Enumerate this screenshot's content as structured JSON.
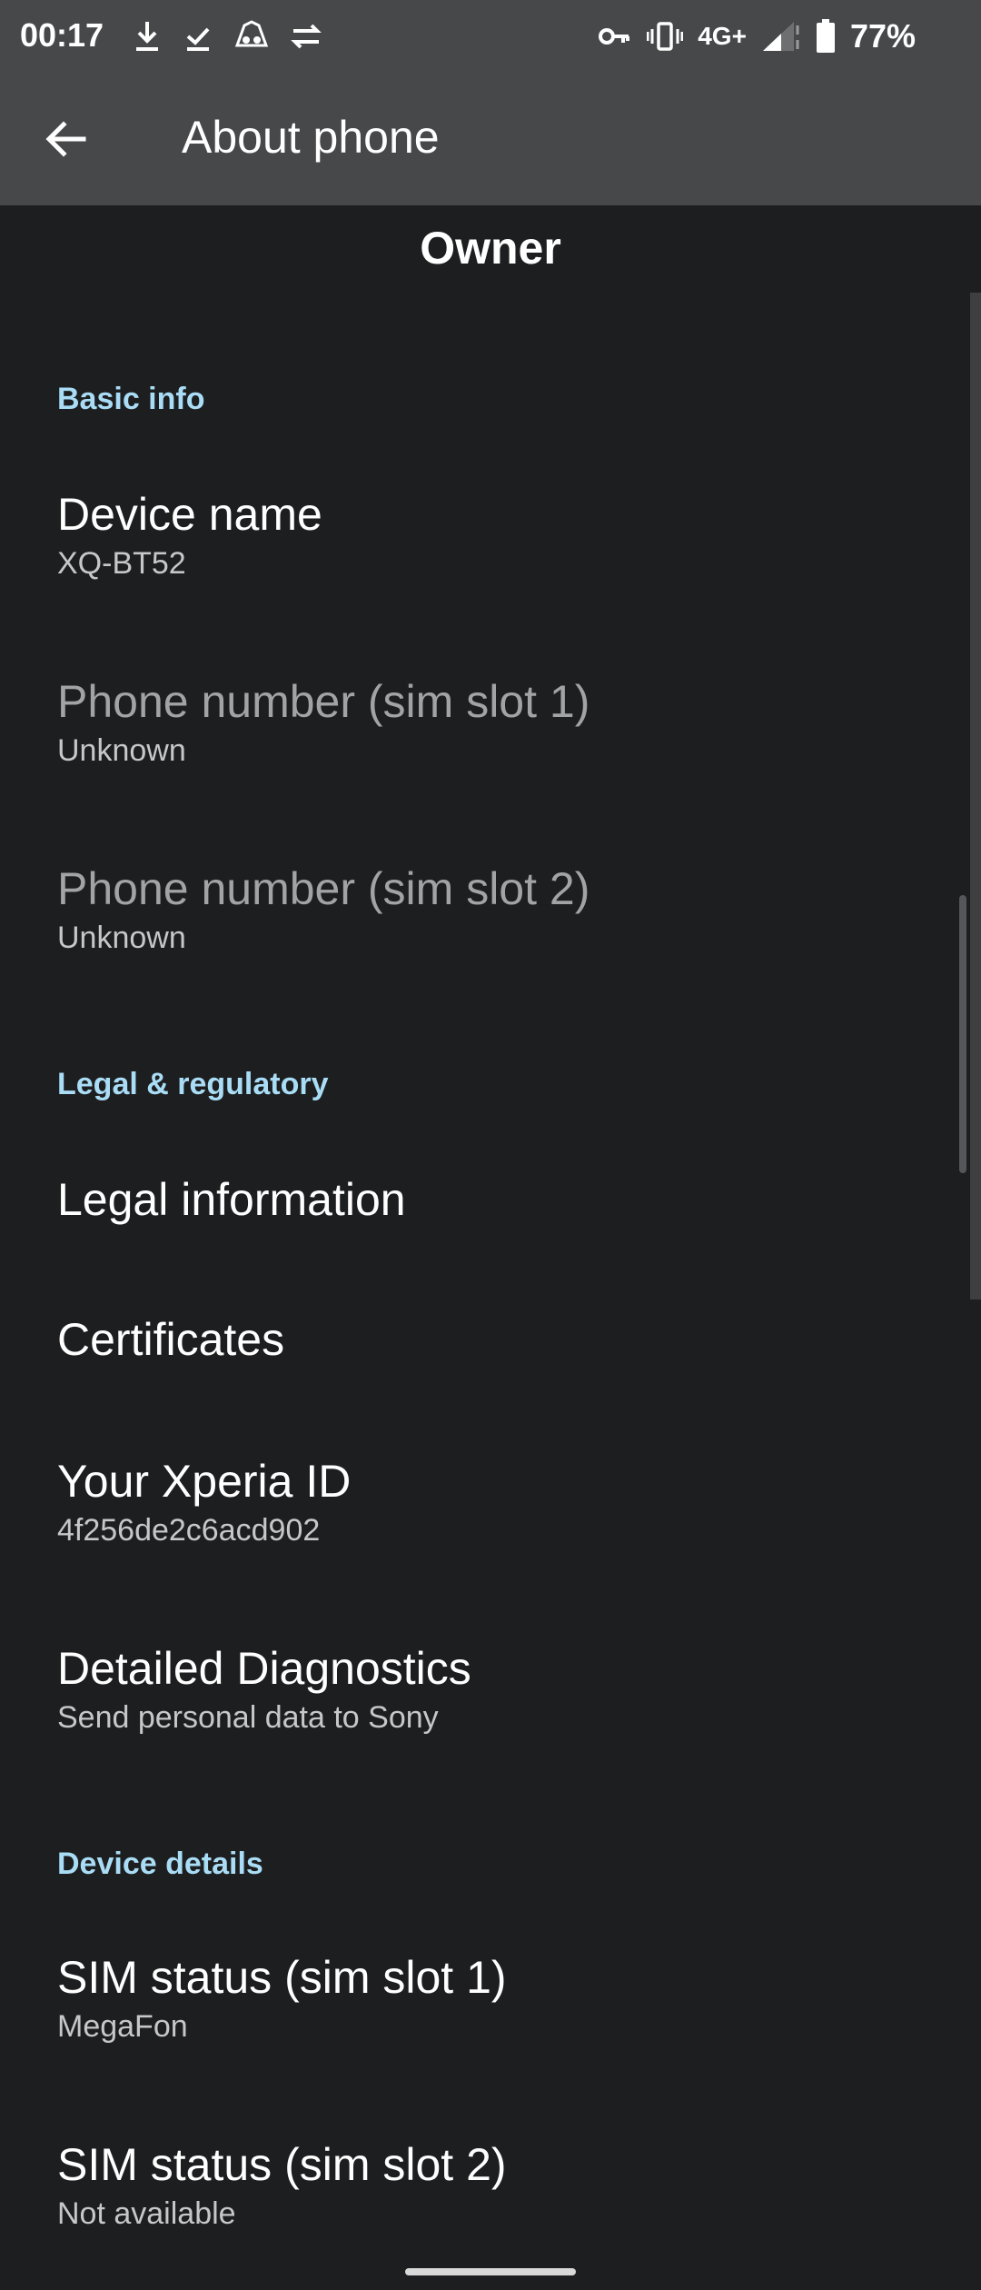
{
  "status_bar": {
    "time": "00:17",
    "network": "4G+",
    "battery": "77%",
    "left_icons": [
      "download-icon",
      "download-done-icon",
      "incognito-icon",
      "data-transfer-icon"
    ],
    "right_icons": [
      "vpn-key-icon",
      "vibrate-icon",
      "signal-icon",
      "battery-icon"
    ]
  },
  "app_bar": {
    "title": "About phone",
    "back_icon": "arrow-back-icon"
  },
  "owner": "Owner",
  "sections": {
    "basic_info": {
      "header": "Basic info",
      "device_name": {
        "title": "Device name",
        "value": "XQ-BT52"
      },
      "phone_sim1": {
        "title": "Phone number (sim slot 1)",
        "value": "Unknown"
      },
      "phone_sim2": {
        "title": "Phone number (sim slot 2)",
        "value": "Unknown"
      }
    },
    "legal": {
      "header": "Legal & regulatory",
      "legal_information": {
        "title": "Legal information"
      },
      "certificates": {
        "title": "Certificates"
      },
      "xperia_id": {
        "title": "Your Xperia ID",
        "value": "4f256de2c6acd902"
      },
      "diagnostics": {
        "title": "Detailed Diagnostics",
        "value": "Send personal data to Sony"
      }
    },
    "device_details": {
      "header": "Device details",
      "sim_status1": {
        "title": "SIM status (sim slot 1)",
        "value": "MegaFon"
      },
      "sim_status2": {
        "title": "SIM status (sim slot 2)",
        "value": "Not available"
      }
    }
  },
  "colors": {
    "background": "#1d1e20",
    "app_bar": "#47484a",
    "section_header": "#a9dcf5",
    "disabled_text": "#a2a3a5"
  }
}
